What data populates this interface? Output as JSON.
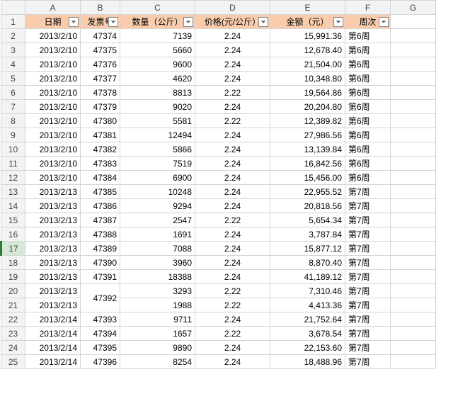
{
  "columns": [
    "A",
    "B",
    "C",
    "D",
    "E",
    "F",
    "G"
  ],
  "headers": [
    "日期",
    "发票号",
    "数量（公斤）",
    "价格(元/公斤）",
    "金额（元）",
    "周次"
  ],
  "rows": [
    {
      "r": 2,
      "date": "2013/2/10",
      "inv": "47374",
      "qty": "7139",
      "price": "2.24",
      "amt": "15,991.36",
      "wk": "第6周"
    },
    {
      "r": 3,
      "date": "2013/2/10",
      "inv": "47375",
      "qty": "5660",
      "price": "2.24",
      "amt": "12,678.40",
      "wk": "第6周"
    },
    {
      "r": 4,
      "date": "2013/2/10",
      "inv": "47376",
      "qty": "9600",
      "price": "2.24",
      "amt": "21,504.00",
      "wk": "第6周"
    },
    {
      "r": 5,
      "date": "2013/2/10",
      "inv": "47377",
      "qty": "4620",
      "price": "2.24",
      "amt": "10,348.80",
      "wk": "第6周"
    },
    {
      "r": 6,
      "date": "2013/2/10",
      "inv": "47378",
      "qty": "8813",
      "price": "2.22",
      "amt": "19,564.86",
      "wk": "第6周"
    },
    {
      "r": 7,
      "date": "2013/2/10",
      "inv": "47379",
      "qty": "9020",
      "price": "2.24",
      "amt": "20,204.80",
      "wk": "第6周"
    },
    {
      "r": 8,
      "date": "2013/2/10",
      "inv": "47380",
      "qty": "5581",
      "price": "2.22",
      "amt": "12,389.82",
      "wk": "第6周"
    },
    {
      "r": 9,
      "date": "2013/2/10",
      "inv": "47381",
      "qty": "12494",
      "price": "2.24",
      "amt": "27,986.56",
      "wk": "第6周"
    },
    {
      "r": 10,
      "date": "2013/2/10",
      "inv": "47382",
      "qty": "5866",
      "price": "2.24",
      "amt": "13,139.84",
      "wk": "第6周"
    },
    {
      "r": 11,
      "date": "2013/2/10",
      "inv": "47383",
      "qty": "7519",
      "price": "2.24",
      "amt": "16,842.56",
      "wk": "第6周"
    },
    {
      "r": 12,
      "date": "2013/2/10",
      "inv": "47384",
      "qty": "6900",
      "price": "2.24",
      "amt": "15,456.00",
      "wk": "第6周"
    },
    {
      "r": 13,
      "date": "2013/2/13",
      "inv": "47385",
      "qty": "10248",
      "price": "2.24",
      "amt": "22,955.52",
      "wk": "第7周"
    },
    {
      "r": 14,
      "date": "2013/2/13",
      "inv": "47386",
      "qty": "9294",
      "price": "2.24",
      "amt": "20,818.56",
      "wk": "第7周"
    },
    {
      "r": 15,
      "date": "2013/2/13",
      "inv": "47387",
      "qty": "2547",
      "price": "2.22",
      "amt": "5,654.34",
      "wk": "第7周"
    },
    {
      "r": 16,
      "date": "2013/2/13",
      "inv": "47388",
      "qty": "1691",
      "price": "2.24",
      "amt": "3,787.84",
      "wk": "第7周"
    },
    {
      "r": 17,
      "date": "2013/2/13",
      "inv": "47389",
      "qty": "7088",
      "price": "2.24",
      "amt": "15,877.12",
      "wk": "第7周",
      "sel": true
    },
    {
      "r": 18,
      "date": "2013/2/13",
      "inv": "47390",
      "qty": "3960",
      "price": "2.24",
      "amt": "8,870.40",
      "wk": "第7周"
    },
    {
      "r": 19,
      "date": "2013/2/13",
      "inv": "47391",
      "qty": "18388",
      "price": "2.24",
      "amt": "41,189.12",
      "wk": "第7周"
    },
    {
      "r": 20,
      "date": "2013/2/13",
      "inv": "47392",
      "qty": "3293",
      "price": "2.22",
      "amt": "7,310.46",
      "wk": "第7周",
      "merge": "start"
    },
    {
      "r": 21,
      "date": "2013/2/13",
      "inv": "",
      "qty": "1988",
      "price": "2.22",
      "amt": "4,413.36",
      "wk": "第7周",
      "merge": "end"
    },
    {
      "r": 22,
      "date": "2013/2/14",
      "inv": "47393",
      "qty": "9711",
      "price": "2.24",
      "amt": "21,752.64",
      "wk": "第7周"
    },
    {
      "r": 23,
      "date": "2013/2/14",
      "inv": "47394",
      "qty": "1657",
      "price": "2.22",
      "amt": "3,678.54",
      "wk": "第7周"
    },
    {
      "r": 24,
      "date": "2013/2/14",
      "inv": "47395",
      "qty": "9890",
      "price": "2.24",
      "amt": "22,153.60",
      "wk": "第7周"
    },
    {
      "r": 25,
      "date": "2013/2/14",
      "inv": "47396",
      "qty": "8254",
      "price": "2.24",
      "amt": "18,488.96",
      "wk": "第7周"
    }
  ]
}
